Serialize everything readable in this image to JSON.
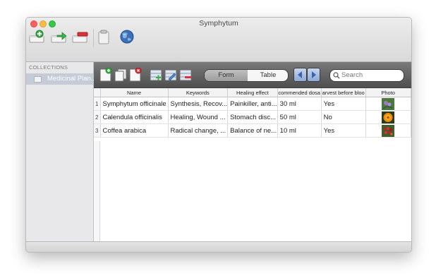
{
  "window": {
    "title": "Symphytum"
  },
  "sidebar": {
    "heading": "COLLECTIONS",
    "items": [
      {
        "label": "Medicinal Plan..."
      }
    ]
  },
  "view_switch": {
    "form_label": "Form",
    "table_label": "Table",
    "selected": "Table"
  },
  "search": {
    "placeholder": "Search"
  },
  "table": {
    "columns": [
      "",
      "Name",
      "Keywords",
      "Healing effect",
      "commended dosa",
      "arvest before bloo",
      "Photo"
    ],
    "rows": [
      {
        "num": "1",
        "name": "Symphytum officinale",
        "keywords": "Synthesis, Recov...",
        "effect": "Painkiller, anti...",
        "dosage": "30 ml",
        "harvest": "Yes",
        "photo": "comfrey-photo"
      },
      {
        "num": "2",
        "name": "Calendula officinalis",
        "keywords": "Healing, Wound ...",
        "effect": "Stomach disc...",
        "dosage": "50 ml",
        "harvest": "No",
        "photo": "marigold-photo"
      },
      {
        "num": "3",
        "name": "Coffea arabica",
        "keywords": "Radical change, ...",
        "effect": "Balance of ne...",
        "dosage": "10 ml",
        "harvest": "Yes",
        "photo": "coffee-photo"
      }
    ]
  },
  "icons": {
    "toolbar": [
      "new-collection-icon",
      "duplicate-collection-icon",
      "delete-collection-icon",
      "clipboard-icon",
      "globe-icon"
    ],
    "record": [
      "new-record-icon",
      "duplicate-record-icon",
      "delete-record-icon",
      "add-field-icon",
      "modify-field-icon",
      "delete-field-icon",
      "previous-icon",
      "next-icon",
      "search-icon"
    ]
  }
}
